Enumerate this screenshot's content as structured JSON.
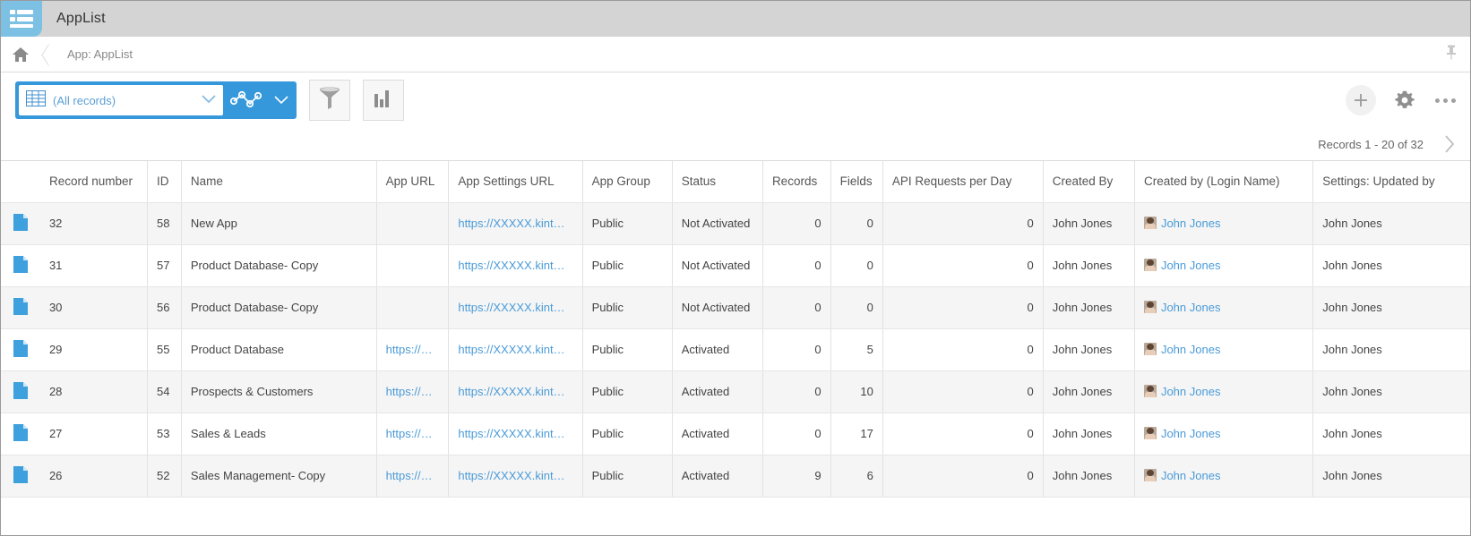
{
  "window": {
    "app_icon": "list-icon",
    "title": "AppList"
  },
  "breadcrumb": {
    "home_icon": "home-icon",
    "path": "App: AppList",
    "pin_icon": "pin-icon"
  },
  "toolbar": {
    "view_selector": {
      "grid_icon": "table-grid-icon",
      "value": "(All records)",
      "chevron_icon": "chevron-down-icon",
      "graph_icon": "graph-nodes-icon",
      "graph_chevron_icon": "chevron-down-icon"
    },
    "filter_button": "filter-funnel-icon",
    "chart_button": "bar-chart-icon",
    "add_button": "plus-icon",
    "settings_button": "gear-icon",
    "more_button": "ellipsis-icon"
  },
  "records_bar": {
    "summary": "Records 1 - 20 of 32",
    "next_icon": "chevron-right-icon"
  },
  "table": {
    "columns": [
      "Record number",
      "ID",
      "Name",
      "App URL",
      "App Settings URL",
      "App Group",
      "Status",
      "Records",
      "Fields",
      "API Requests per Day",
      "Created By",
      "Created by (Login Name)",
      "Settings: Updated by"
    ],
    "rows": [
      {
        "record_number": "32",
        "id": "58",
        "name": "New App",
        "app_url": "",
        "app_settings_url": "https://XXXXX.kint…",
        "app_group": "Public",
        "status": "Not Activated",
        "records": "0",
        "fields": "0",
        "api_requests": "0",
        "created_by": "John Jones",
        "created_by_login": "John Jones",
        "settings_updated_by": "John Jones"
      },
      {
        "record_number": "31",
        "id": "57",
        "name": "Product Database- Copy",
        "app_url": "",
        "app_settings_url": "https://XXXXX.kint…",
        "app_group": "Public",
        "status": "Not Activated",
        "records": "0",
        "fields": "0",
        "api_requests": "0",
        "created_by": "John Jones",
        "created_by_login": "John Jones",
        "settings_updated_by": "John Jones"
      },
      {
        "record_number": "30",
        "id": "56",
        "name": "Product Database- Copy",
        "app_url": "",
        "app_settings_url": "https://XXXXX.kint…",
        "app_group": "Public",
        "status": "Not Activated",
        "records": "0",
        "fields": "0",
        "api_requests": "0",
        "created_by": "John Jones",
        "created_by_login": "John Jones",
        "settings_updated_by": "John Jones"
      },
      {
        "record_number": "29",
        "id": "55",
        "name": "Product Database",
        "app_url": "https://…",
        "app_settings_url": "https://XXXXX.kint…",
        "app_group": "Public",
        "status": "Activated",
        "records": "0",
        "fields": "5",
        "api_requests": "0",
        "created_by": "John Jones",
        "created_by_login": "John Jones",
        "settings_updated_by": "John Jones"
      },
      {
        "record_number": "28",
        "id": "54",
        "name": "Prospects & Customers",
        "app_url": "https://…",
        "app_settings_url": "https://XXXXX.kint…",
        "app_group": "Public",
        "status": "Activated",
        "records": "0",
        "fields": "10",
        "api_requests": "0",
        "created_by": "John Jones",
        "created_by_login": "John Jones",
        "settings_updated_by": "John Jones"
      },
      {
        "record_number": "27",
        "id": "53",
        "name": "Sales & Leads",
        "app_url": "https://…",
        "app_settings_url": "https://XXXXX.kint…",
        "app_group": "Public",
        "status": "Activated",
        "records": "0",
        "fields": "17",
        "api_requests": "0",
        "created_by": "John Jones",
        "created_by_login": "John Jones",
        "settings_updated_by": "John Jones"
      },
      {
        "record_number": "26",
        "id": "52",
        "name": "Sales Management- Copy",
        "app_url": "https://…",
        "app_settings_url": "https://XXXXX.kint…",
        "app_group": "Public",
        "status": "Activated",
        "records": "9",
        "fields": "6",
        "api_requests": "0",
        "created_by": "John Jones",
        "created_by_login": "John Jones",
        "settings_updated_by": "John Jones"
      }
    ]
  },
  "colors": {
    "accent": "#3498db",
    "link": "#4a9bd8",
    "titlebar": "#d4d4d4",
    "app_icon": "#7cc1e4",
    "row_stripe": "#f5f5f5"
  }
}
